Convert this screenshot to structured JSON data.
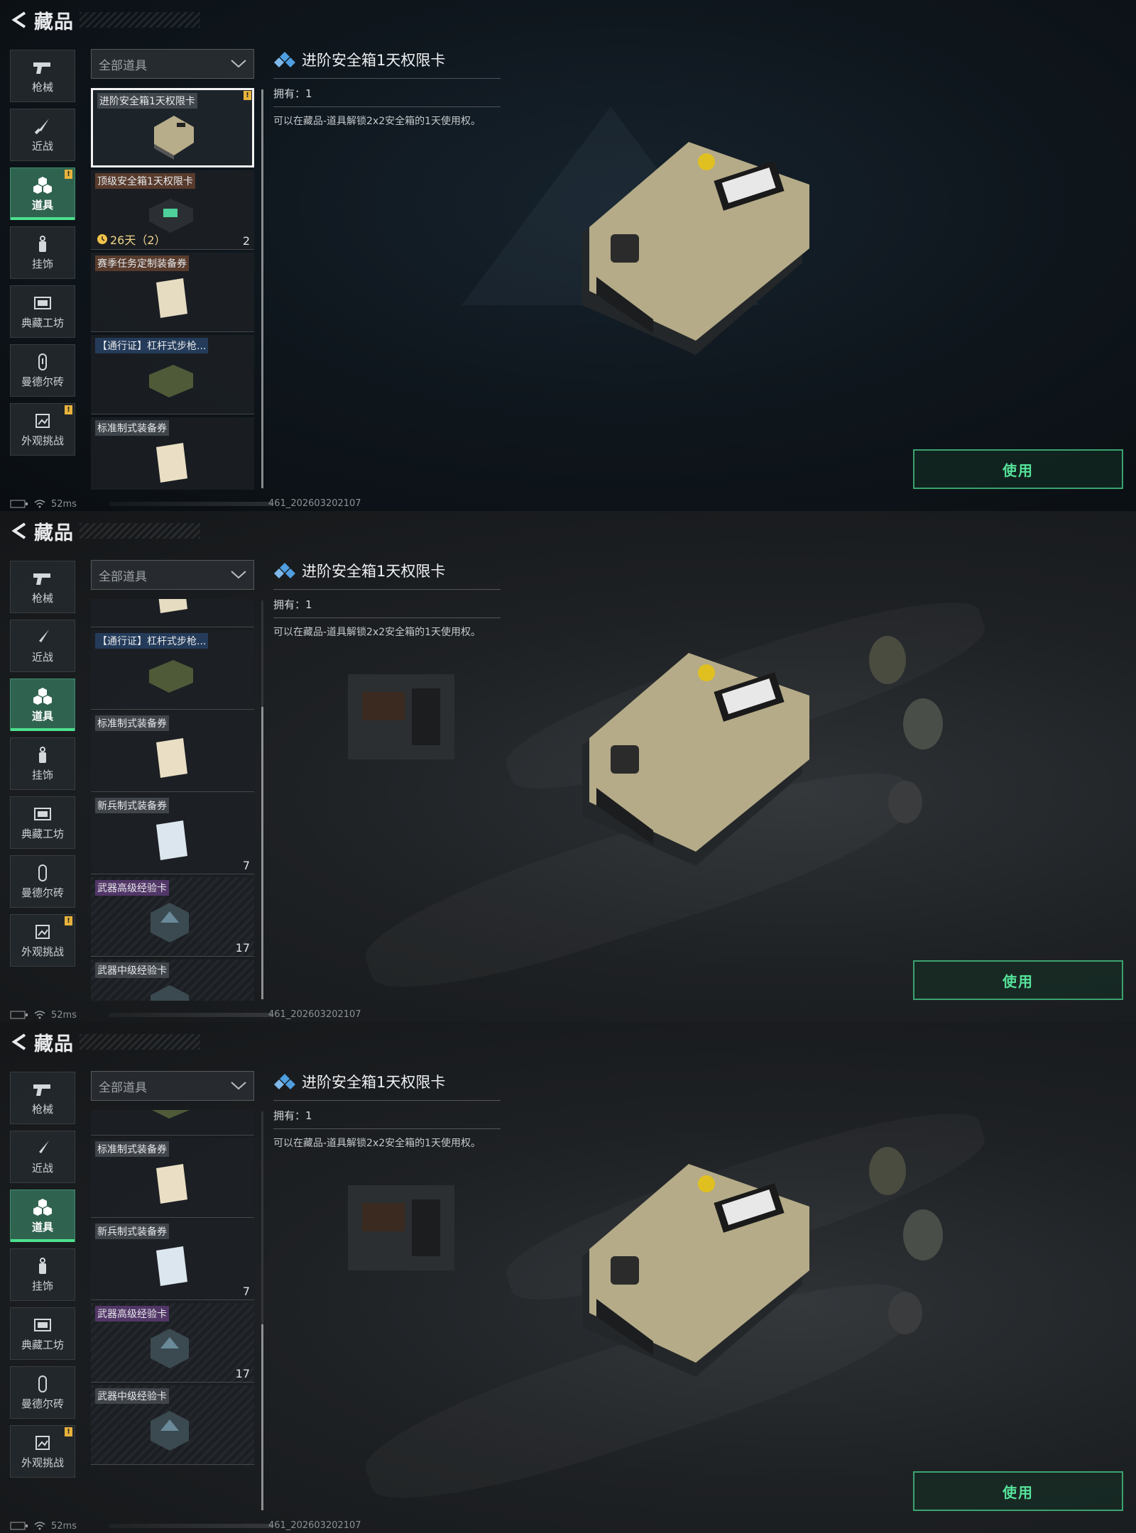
{
  "header": {
    "title": "藏品"
  },
  "nav": [
    {
      "label": "枪械",
      "icon": "gun-icon",
      "active": false,
      "badge": ""
    },
    {
      "label": "近战",
      "icon": "knife-icon",
      "active": false,
      "badge": ""
    },
    {
      "label": "道具",
      "icon": "items-icon",
      "active": true,
      "badge": "!"
    },
    {
      "label": "挂饰",
      "icon": "charm-icon",
      "active": false,
      "badge": ""
    },
    {
      "label": "典藏工坊",
      "icon": "workshop-icon",
      "active": false,
      "badge": ""
    },
    {
      "label": "曼德尔砖",
      "icon": "brick-icon",
      "active": false,
      "badge": ""
    },
    {
      "label": "外观挑战",
      "icon": "challenge-icon",
      "active": false,
      "badge": "!"
    }
  ],
  "filter": {
    "label": "全部道具"
  },
  "items": {
    "advanced_safe": {
      "name": "进阶安全箱1天权限卡",
      "badge": "!"
    },
    "top_safe": {
      "name": "顶级安全箱1天权限卡",
      "timer": "26天（2）",
      "count": "2"
    },
    "season_voucher": {
      "name": "赛季任务定制装备券"
    },
    "pass_rifle": {
      "name": "【通行证】杠杆式步枪..."
    },
    "standard_voucher": {
      "name": "标准制式装备券"
    },
    "recruit_voucher": {
      "name": "新兵制式装备券",
      "count": "7"
    },
    "weapon_adv_exp": {
      "name": "武器高级经验卡",
      "count": "17"
    },
    "weapon_mid_exp": {
      "name": "武器中级经验卡"
    }
  },
  "detail": {
    "title": "进阶安全箱1天权限卡",
    "owned": "拥有：1",
    "description": "可以在藏品-道具解锁2x2安全箱的1天使用权。"
  },
  "use_button": {
    "label": "使用"
  },
  "status": {
    "ping": "52ms",
    "build": "461_202603202107"
  },
  "colors": {
    "accent_green": "#4ee08f",
    "badge_yellow": "#e8b33c",
    "nav_active": "#2f6350"
  }
}
